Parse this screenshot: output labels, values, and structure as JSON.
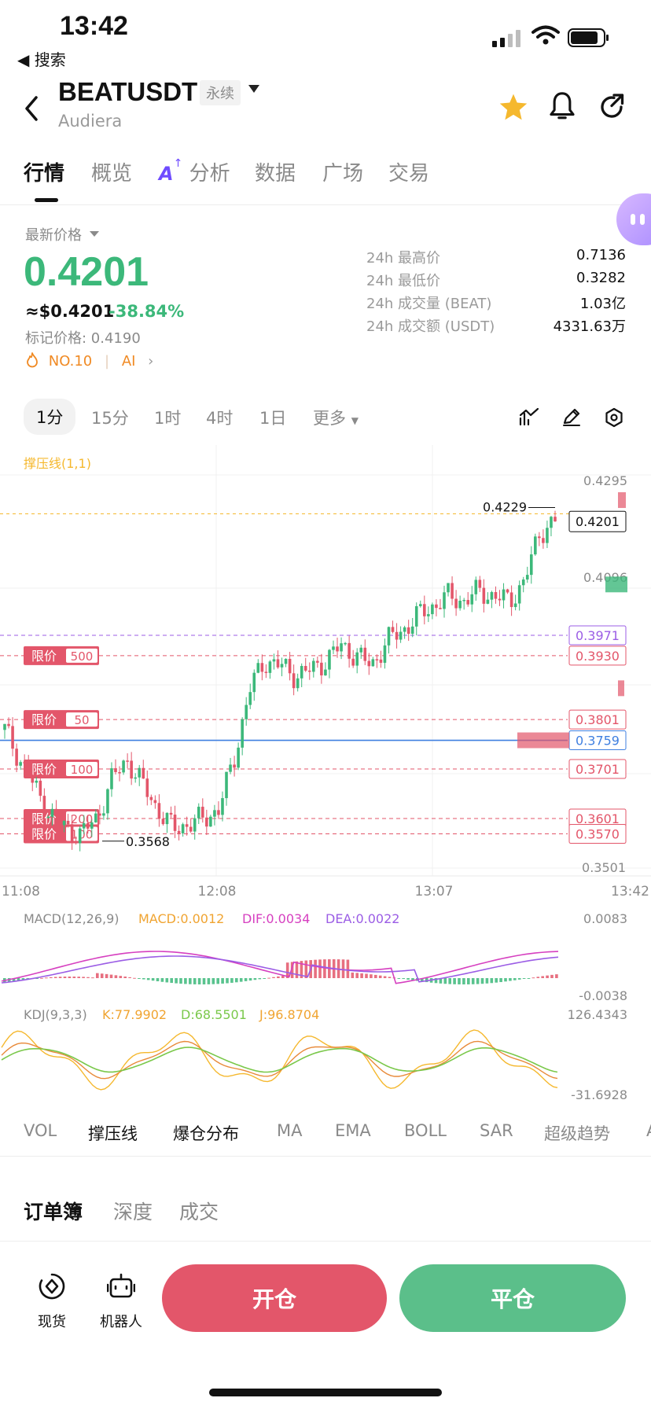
{
  "status_bar": {
    "time": "13:42",
    "back_app": "◀ 搜索"
  },
  "header": {
    "pair": "BEATUSDT",
    "contract_tag": "永续",
    "subtitle": "Audiera"
  },
  "main_tabs": [
    {
      "label": "行情",
      "active": true
    },
    {
      "label": "概览",
      "active": false
    },
    {
      "label": "分析",
      "prefix": "A",
      "active": false
    },
    {
      "label": "数据",
      "active": false
    },
    {
      "label": "广场",
      "active": false
    },
    {
      "label": "交易",
      "active": false
    }
  ],
  "price": {
    "label": "最新价格",
    "last": "0.4201",
    "usd": "≈$0.4201",
    "change": "-38.84%",
    "mark": "标记价格: 0.4190",
    "rank": "NO.10",
    "ai": "AI"
  },
  "stats": [
    {
      "label": "24h 最高价",
      "value": "0.7136"
    },
    {
      "label": "24h 最低价",
      "value": "0.3282"
    },
    {
      "label": "24h 成交量 (BEAT)",
      "value": "1.03亿"
    },
    {
      "label": "24h 成交额 (USDT)",
      "value": "4331.63万"
    }
  ],
  "timeframes": [
    "1分",
    "15分",
    "1时",
    "4时",
    "1日",
    "更多"
  ],
  "active_timeframe": "1分",
  "chart_data": {
    "type": "candlestick",
    "indicator_label": "撑压线(1,1)",
    "ylim": [
      0.3501,
      0.4295
    ],
    "y_ticks": [
      "0.4295",
      "0.4096",
      "0.3501"
    ],
    "x_ticks": [
      "11:08",
      "12:08",
      "13:07",
      "13:42"
    ],
    "current_price": "0.4201",
    "high_marker": "0.4229",
    "low_marker": "0.3568",
    "price_lines": [
      {
        "price": 0.3971,
        "label": "0.3971",
        "color": "#9b5de5"
      },
      {
        "price": 0.393,
        "label": "0.3930",
        "color": "#e3566a"
      },
      {
        "price": 0.3801,
        "label": "0.3801",
        "color": "#e3566a"
      },
      {
        "price": 0.3759,
        "label": "0.3759",
        "color": "#3f7fe0"
      },
      {
        "price": 0.3701,
        "label": "0.3701",
        "color": "#e3566a"
      },
      {
        "price": 0.3601,
        "label": "0.3601",
        "color": "#e3566a"
      },
      {
        "price": 0.357,
        "label": "0.3570",
        "color": "#e3566a"
      }
    ],
    "limit_orders": [
      {
        "label": "限价",
        "qty": "500",
        "price": 0.393
      },
      {
        "label": "限价",
        "qty": "50",
        "price": 0.3801
      },
      {
        "label": "限价",
        "qty": "100",
        "price": 0.3701
      },
      {
        "label": "限价",
        "qty": "200",
        "price": 0.3601
      },
      {
        "label": "限价",
        "qty": "100",
        "price": 0.357
      }
    ],
    "close_path": [
      0.378,
      0.372,
      0.366,
      0.361,
      0.358,
      0.357,
      0.36,
      0.368,
      0.372,
      0.367,
      0.362,
      0.358,
      0.359,
      0.36,
      0.362,
      0.372,
      0.386,
      0.392,
      0.391,
      0.389,
      0.39,
      0.392,
      0.395,
      0.393,
      0.391,
      0.396,
      0.398,
      0.401,
      0.403,
      0.405,
      0.404,
      0.406,
      0.405,
      0.404,
      0.408,
      0.418,
      0.4201
    ],
    "macd": {
      "label": "MACD(12,26,9)",
      "macd": "MACD:0.0012",
      "dif": "DIF:0.0034",
      "dea": "DEA:0.0022",
      "top": "0.0083",
      "bottom": "-0.0038"
    },
    "kdj": {
      "label": "KDJ(9,3,3)",
      "k": "K:77.9902",
      "d": "D:68.5501",
      "j": "J:96.8704",
      "top": "126.4343",
      "bottom": "-31.6928"
    }
  },
  "indicator_tabs": [
    "VOL",
    "撑压线",
    "爆仓分布",
    "MA",
    "EMA",
    "BOLL",
    "SAR",
    "超级趋势",
    "A"
  ],
  "orderbook_tabs": [
    "订单簿",
    "深度",
    "成交"
  ],
  "bottom_bar": {
    "spot": "现货",
    "bot": "机器人",
    "open": "开仓",
    "close": "平仓"
  },
  "colors": {
    "up": "#3cb87a",
    "down": "#e3566a",
    "accent": "#f5b82e"
  }
}
